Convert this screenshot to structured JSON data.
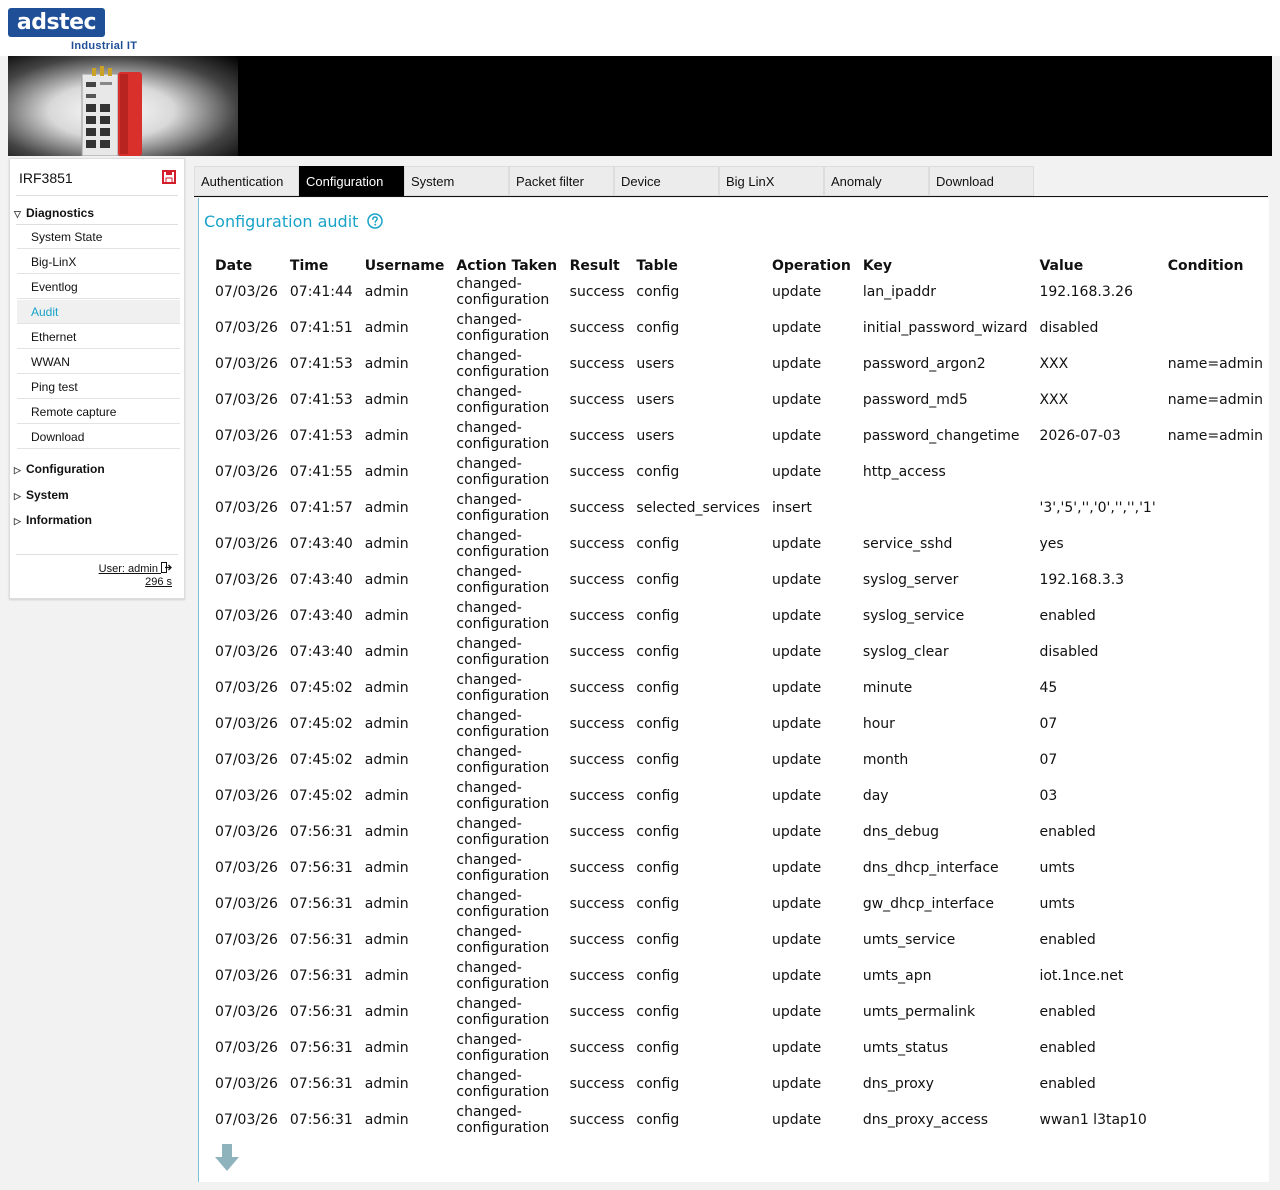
{
  "brand": {
    "logo_text": "adstec",
    "logo_sub": "Industrial IT",
    "primary_color": "#1f4f97",
    "accent_color": "#1aa3c8"
  },
  "sidebar": {
    "device_name": "IRF3851",
    "diagnostics": {
      "label": "Diagnostics",
      "items": [
        "System State",
        "Big-LinX",
        "Eventlog",
        "Audit",
        "Ethernet",
        "WWAN",
        "Ping test",
        "Remote capture",
        "Download"
      ],
      "active": "Audit"
    },
    "sections": [
      "Configuration",
      "System",
      "Information"
    ],
    "user_label": "User: admin",
    "timer": "296 s"
  },
  "tabs": {
    "items": [
      "Authentication",
      "Configuration",
      "System",
      "Packet filter",
      "Device",
      "Big LinX",
      "Anomaly",
      "Download"
    ],
    "active": "Configuration"
  },
  "content": {
    "title": "Configuration audit",
    "columns": [
      "Date",
      "Time",
      "Username",
      "Action Taken",
      "Result",
      "Table",
      "Operation",
      "Key",
      "Value",
      "Condition"
    ],
    "rows": [
      [
        "07/03/26",
        "07:41:44",
        "admin",
        "changed-configuration",
        "success",
        "config",
        "update",
        "lan_ipaddr",
        "192.168.3.26",
        ""
      ],
      [
        "07/03/26",
        "07:41:51",
        "admin",
        "changed-configuration",
        "success",
        "config",
        "update",
        "initial_password_wizard",
        "disabled",
        ""
      ],
      [
        "07/03/26",
        "07:41:53",
        "admin",
        "changed-configuration",
        "success",
        "users",
        "update",
        "password_argon2",
        "XXX",
        "name=admin"
      ],
      [
        "07/03/26",
        "07:41:53",
        "admin",
        "changed-configuration",
        "success",
        "users",
        "update",
        "password_md5",
        "XXX",
        "name=admin"
      ],
      [
        "07/03/26",
        "07:41:53",
        "admin",
        "changed-configuration",
        "success",
        "users",
        "update",
        "password_changetime",
        "2026-07-03",
        "name=admin"
      ],
      [
        "07/03/26",
        "07:41:55",
        "admin",
        "changed-configuration",
        "success",
        "config",
        "update",
        "http_access",
        "",
        ""
      ],
      [
        "07/03/26",
        "07:41:57",
        "admin",
        "changed-configuration",
        "success",
        "selected_services",
        "insert",
        "",
        "'3','5','','0','','','1'",
        ""
      ],
      [
        "07/03/26",
        "07:43:40",
        "admin",
        "changed-configuration",
        "success",
        "config",
        "update",
        "service_sshd",
        "yes",
        ""
      ],
      [
        "07/03/26",
        "07:43:40",
        "admin",
        "changed-configuration",
        "success",
        "config",
        "update",
        "syslog_server",
        "192.168.3.3",
        ""
      ],
      [
        "07/03/26",
        "07:43:40",
        "admin",
        "changed-configuration",
        "success",
        "config",
        "update",
        "syslog_service",
        "enabled",
        ""
      ],
      [
        "07/03/26",
        "07:43:40",
        "admin",
        "changed-configuration",
        "success",
        "config",
        "update",
        "syslog_clear",
        "disabled",
        ""
      ],
      [
        "07/03/26",
        "07:45:02",
        "admin",
        "changed-configuration",
        "success",
        "config",
        "update",
        "minute",
        "45",
        ""
      ],
      [
        "07/03/26",
        "07:45:02",
        "admin",
        "changed-configuration",
        "success",
        "config",
        "update",
        "hour",
        "07",
        ""
      ],
      [
        "07/03/26",
        "07:45:02",
        "admin",
        "changed-configuration",
        "success",
        "config",
        "update",
        "month",
        "07",
        ""
      ],
      [
        "07/03/26",
        "07:45:02",
        "admin",
        "changed-configuration",
        "success",
        "config",
        "update",
        "day",
        "03",
        ""
      ],
      [
        "07/03/26",
        "07:56:31",
        "admin",
        "changed-configuration",
        "success",
        "config",
        "update",
        "dns_debug",
        "enabled",
        ""
      ],
      [
        "07/03/26",
        "07:56:31",
        "admin",
        "changed-configuration",
        "success",
        "config",
        "update",
        "dns_dhcp_interface",
        "umts",
        ""
      ],
      [
        "07/03/26",
        "07:56:31",
        "admin",
        "changed-configuration",
        "success",
        "config",
        "update",
        "gw_dhcp_interface",
        "umts",
        ""
      ],
      [
        "07/03/26",
        "07:56:31",
        "admin",
        "changed-configuration",
        "success",
        "config",
        "update",
        "umts_service",
        "enabled",
        ""
      ],
      [
        "07/03/26",
        "07:56:31",
        "admin",
        "changed-configuration",
        "success",
        "config",
        "update",
        "umts_apn",
        "iot.1nce.net",
        ""
      ],
      [
        "07/03/26",
        "07:56:31",
        "admin",
        "changed-configuration",
        "success",
        "config",
        "update",
        "umts_permalink",
        "enabled",
        ""
      ],
      [
        "07/03/26",
        "07:56:31",
        "admin",
        "changed-configuration",
        "success",
        "config",
        "update",
        "umts_status",
        "enabled",
        ""
      ],
      [
        "07/03/26",
        "07:56:31",
        "admin",
        "changed-configuration",
        "success",
        "config",
        "update",
        "dns_proxy",
        "enabled",
        ""
      ],
      [
        "07/03/26",
        "07:56:31",
        "admin",
        "changed-configuration",
        "success",
        "config",
        "update",
        "dns_proxy_access",
        "wwan1 l3tap10",
        ""
      ]
    ]
  }
}
